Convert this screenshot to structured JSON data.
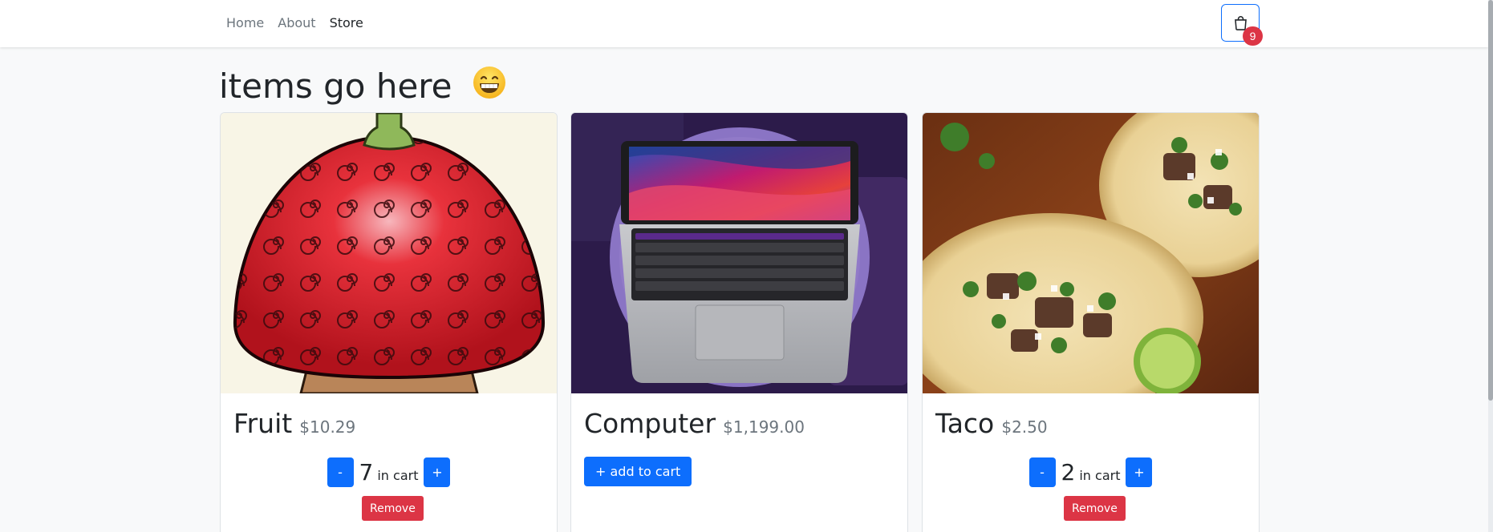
{
  "navbar": {
    "links": [
      {
        "label": "Home",
        "active": false
      },
      {
        "label": "About",
        "active": false
      },
      {
        "label": "Store",
        "active": true
      }
    ],
    "cart_count": "9",
    "cart_icon": "shopping-bag-icon"
  },
  "page": {
    "title": "items go here",
    "title_emoji": "grinning-face-icon"
  },
  "products": [
    {
      "name": "Fruit",
      "price": "$10.29",
      "quantity": "7",
      "in_cart_label": "in cart",
      "minus_label": "-",
      "plus_label": "+",
      "remove_label": "Remove",
      "image": "devil-fruit"
    },
    {
      "name": "Computer",
      "price": "$1,199.00",
      "add_label": "+ add to cart",
      "image": "laptop"
    },
    {
      "name": "Taco",
      "price": "$2.50",
      "quantity": "2",
      "in_cart_label": "in cart",
      "minus_label": "-",
      "plus_label": "+",
      "remove_label": "Remove",
      "image": "tacos"
    }
  ],
  "colors": {
    "primary": "#0d6efd",
    "danger": "#dc3545",
    "background": "#f8f9fa"
  }
}
